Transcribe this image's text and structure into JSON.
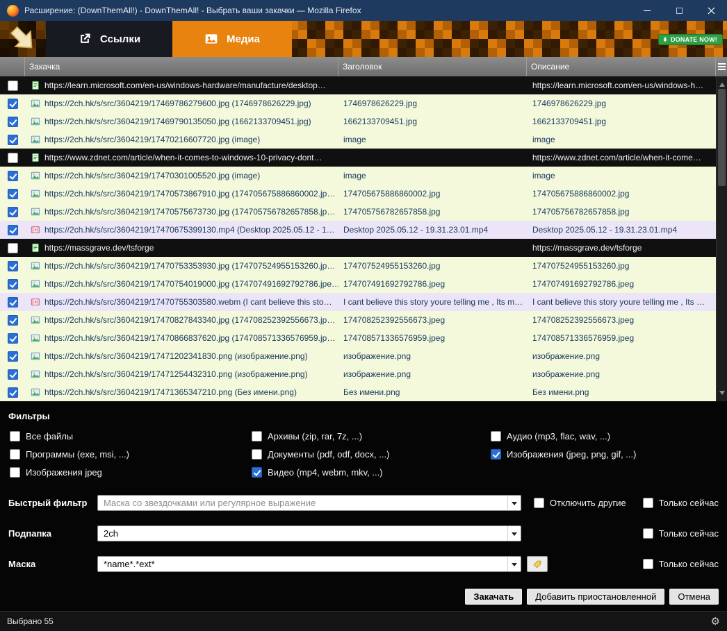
{
  "window": {
    "title": "Расширение: (DownThemAll!) - DownThemAll! - Выбрать ваши закачки — Mozilla Firefox"
  },
  "tabs": [
    {
      "label": "Ссылки",
      "active": true
    },
    {
      "label": "Медиа",
      "active": false
    }
  ],
  "donate": {
    "label": "DONATE NOW!"
  },
  "icons": {
    "gear": "⚙"
  },
  "colors": {
    "accent_orange": "#e8830f",
    "title_bar": "#1e3a5f",
    "row_checked_bg": "#f3f9da",
    "row_media_bg": "#ece5f7",
    "row_unchecked_bg": "#101010",
    "checkbox_checked": "#2a6fd6",
    "donate_green": "#2f9e44"
  },
  "table": {
    "columns": [
      "Закачка",
      "Заголовок",
      "Описание"
    ],
    "rows": [
      {
        "kind": "dark",
        "icon": "page",
        "checked": false,
        "url": "https://learn.microsoft.com/en-us/windows-hardware/manufacture/desktop…",
        "title": "",
        "desc": "https://learn.microsoft.com/en-us/windows-h…"
      },
      {
        "kind": "light",
        "icon": "image",
        "checked": true,
        "url": "https://2ch.hk/s/src/3604219/17469786279600.jpg (1746978626229.jpg)",
        "title": "1746978626229.jpg",
        "desc": "1746978626229.jpg"
      },
      {
        "kind": "light",
        "icon": "image",
        "checked": true,
        "url": "https://2ch.hk/s/src/3604219/17469790135050.jpg (1662133709451.jpg)",
        "title": "1662133709451.jpg",
        "desc": "1662133709451.jpg"
      },
      {
        "kind": "light",
        "icon": "image",
        "checked": true,
        "url": "https://2ch.hk/s/src/3604219/17470216607720.jpg (image)",
        "title": "image",
        "desc": "image"
      },
      {
        "kind": "dark",
        "icon": "page",
        "checked": false,
        "url": "https://www.zdnet.com/article/when-it-comes-to-windows-10-privacy-dont…",
        "title": "",
        "desc": "https://www.zdnet.com/article/when-it-come…"
      },
      {
        "kind": "light",
        "icon": "image",
        "checked": true,
        "url": "https://2ch.hk/s/src/3604219/17470301005520.jpg (image)",
        "title": "image",
        "desc": "image"
      },
      {
        "kind": "light",
        "icon": "image",
        "checked": true,
        "url": "https://2ch.hk/s/src/3604219/17470573867910.jpg (174705675886860002.jp…",
        "title": "174705675886860002.jpg",
        "desc": "174705675886860002.jpg"
      },
      {
        "kind": "light",
        "icon": "image",
        "checked": true,
        "url": "https://2ch.hk/s/src/3604219/17470575673730.jpg (174705756782657858.jp…",
        "title": "174705756782657858.jpg",
        "desc": "174705756782657858.jpg"
      },
      {
        "kind": "media",
        "icon": "video",
        "checked": true,
        "url": "https://2ch.hk/s/src/3604219/17470675399130.mp4 (Desktop 2025.05.12 - 1…",
        "title": "Desktop 2025.05.12 - 19.31.23.01.mp4",
        "desc": "Desktop 2025.05.12 - 19.31.23.01.mp4"
      },
      {
        "kind": "dark",
        "icon": "page",
        "checked": false,
        "url": "https://massgrave.dev/tsforge",
        "title": "",
        "desc": "https://massgrave.dev/tsforge"
      },
      {
        "kind": "light",
        "icon": "image",
        "checked": true,
        "url": "https://2ch.hk/s/src/3604219/17470753353930.jpg (174707524955153260.jp…",
        "title": "174707524955153260.jpg",
        "desc": "174707524955153260.jpg"
      },
      {
        "kind": "light",
        "icon": "image",
        "checked": true,
        "url": "https://2ch.hk/s/src/3604219/17470754019000.jpg (174707491692792786.jpe…",
        "title": "174707491692792786.jpeg",
        "desc": "174707491692792786.jpeg"
      },
      {
        "kind": "media",
        "icon": "video",
        "checked": true,
        "url": "https://2ch.hk/s/src/3604219/17470755303580.webm (I cant believe this sto…",
        "title": "I cant believe this story youre telling me , Its m…",
        "desc": "I cant believe this story youre telling me , Its …"
      },
      {
        "kind": "light",
        "icon": "image",
        "checked": true,
        "url": "https://2ch.hk/s/src/3604219/17470827843340.jpg (174708252392556673.jp…",
        "title": "174708252392556673.jpeg",
        "desc": "174708252392556673.jpeg"
      },
      {
        "kind": "light",
        "icon": "image",
        "checked": true,
        "url": "https://2ch.hk/s/src/3604219/17470866837620.jpg (174708571336576959.jp…",
        "title": "174708571336576959.jpeg",
        "desc": "174708571336576959.jpeg"
      },
      {
        "kind": "light",
        "icon": "image",
        "checked": true,
        "url": "https://2ch.hk/s/src/3604219/17471202341830.png (изображение.png)",
        "title": "изображение.png",
        "desc": "изображение.png"
      },
      {
        "kind": "light",
        "icon": "image",
        "checked": true,
        "url": "https://2ch.hk/s/src/3604219/17471254432310.png (изображение.png)",
        "title": "изображение.png",
        "desc": "изображение.png"
      },
      {
        "kind": "light",
        "icon": "image",
        "checked": true,
        "url": "https://2ch.hk/s/src/3604219/17471365347210.png (Без имени.png)",
        "title": "Без имени.png",
        "desc": "Без имени.png"
      }
    ]
  },
  "filters": {
    "heading": "Фильтры",
    "checkboxes": [
      {
        "label": "Все файлы",
        "checked": false
      },
      {
        "label": "Архивы (zip, rar, 7z, ...)",
        "checked": false
      },
      {
        "label": "Аудио (mp3, flac, wav, ...)",
        "checked": false
      },
      {
        "label": "Программы (exe, msi, ...)",
        "checked": false
      },
      {
        "label": "Документы (pdf, odf, docx, ...)",
        "checked": false
      },
      {
        "label": "Изображения (jpeg, png, gif, ...)",
        "checked": true
      },
      {
        "label": "Изображения jpeg",
        "checked": false
      },
      {
        "label": "Видео (mp4, webm, mkv, ...)",
        "checked": true
      }
    ]
  },
  "quick_filter": {
    "label": "Быстрый фильтр",
    "placeholder": "Маска со звездочками или регулярное выражение",
    "disable_others": "Отключить другие",
    "only_now": "Только сейчас"
  },
  "subfolder": {
    "label": "Подпапка",
    "value": "2ch",
    "only_now": "Только сейчас"
  },
  "mask": {
    "label": "Маска",
    "value": "*name*.*ext*",
    "only_now": "Только сейчас"
  },
  "actions": {
    "download": "Закачать",
    "add_paused": "Добавить приостановленной",
    "cancel": "Отмена"
  },
  "statusbar": {
    "selected": "Выбрано 55"
  }
}
